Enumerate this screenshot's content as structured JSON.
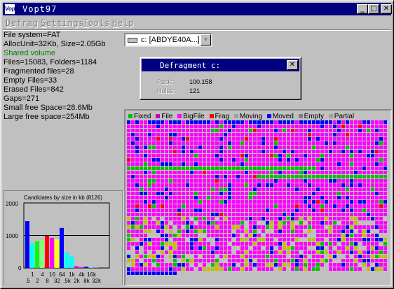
{
  "window": {
    "title": "Vopt97",
    "icon_text": "Vopt",
    "buttons": {
      "minimize": "_",
      "maximize": "□",
      "close": "✕"
    }
  },
  "menu": [
    "Defrag",
    "Settings",
    "Tools",
    "Help"
  ],
  "info": {
    "file_system": "File system=FAT",
    "alloc": "AllocUnit=32Kb,  Size=2.05Gb",
    "shared": "Shared volume",
    "files": "Files=15083,  Folders=1184",
    "fragmented": "Fragmented files=28",
    "empty": "Empty Files=33",
    "erased": "Erased Files=842",
    "gaps": "Gaps=271",
    "small_free": "Small free Space=28.6Mb",
    "large_free": "Large free space=254Mb"
  },
  "colors": {
    "shared": "#008000",
    "accent": "#000080"
  },
  "drive_select": {
    "value": "c: [ABDYE40A...]",
    "icon": "drive-icon"
  },
  "dialog": {
    "title": "Defragment c:",
    "pack_label": "Pack:",
    "pack_value": "100.158",
    "holes_label": "Holes:",
    "holes_value": "121"
  },
  "legend": [
    {
      "label": "Fixed",
      "color": "#00c000"
    },
    {
      "label": "File",
      "color": "#c000c0"
    },
    {
      "label": "BigFile",
      "color": "#ff00ff"
    },
    {
      "label": "Frag",
      "color": "#ff0000"
    },
    {
      "label": "Moving",
      "color": "#c0c0c0"
    },
    {
      "label": "Moved",
      "color": "#0000ff"
    },
    {
      "label": "Empty",
      "color": "#c0c0c0"
    },
    {
      "label": "Partial",
      "color": "#c0c000"
    }
  ],
  "chart_data": {
    "type": "bar",
    "title": "Candidates by size in kb  (8126)",
    "ylim": [
      0,
      2000
    ],
    "yticks": [
      "2000",
      "1000",
      "0"
    ],
    "xticks_top": [
      "1",
      "4",
      "16",
      "64",
      "1k",
      "4k",
      "16k"
    ],
    "xticks_bottom": [
      ".5",
      "2",
      "8",
      "32",
      ".5k",
      "2k",
      "8k",
      "32k"
    ],
    "categories": [
      ".5",
      "1",
      "2",
      "4",
      "8",
      "16",
      "32",
      "64",
      ".5k",
      "1k",
      "2k",
      "4k",
      "8k",
      "16k",
      "32k"
    ],
    "values": [
      1440,
      760,
      820,
      860,
      990,
      930,
      880,
      1230,
      480,
      360,
      60,
      30,
      40,
      20,
      10
    ],
    "colors": [
      "#0000ff",
      "#00ffff",
      "#00ff00",
      "#80ff80",
      "#ff0000",
      "#ff00ff",
      "#ffff00",
      "#0000ff",
      "#00ffff",
      "#00ffff",
      "#ff00ff",
      "#ff00ff",
      "#0000ff",
      "#00ffff",
      "#ff00ff"
    ],
    "gridline": 1000
  }
}
